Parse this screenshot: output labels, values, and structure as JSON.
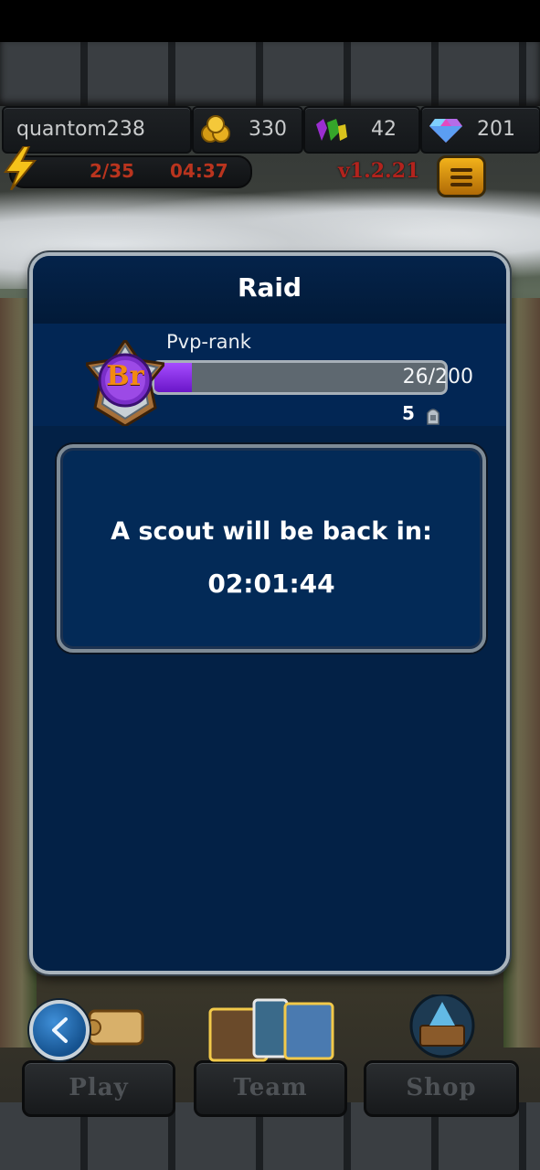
{
  "hud": {
    "player_name": "quantom238",
    "gold": "330",
    "gems": "42",
    "diamonds": "201",
    "energy": "2/35",
    "energy_timer": "04:37",
    "version": "v1.2.21",
    "icons": [
      "coin-icon",
      "gem-icon",
      "diamond-icon",
      "lightning-icon",
      "menu-icon"
    ]
  },
  "dialog": {
    "title": "Raid",
    "rank": {
      "label": "Pvp-rank",
      "badge": "Br",
      "progress_text": "26/200",
      "progress_fraction": 0.13,
      "count": "5"
    },
    "scout": {
      "message": "A scout will be back in:",
      "timer": "02:01:44"
    }
  },
  "nav": {
    "play": "Play",
    "team": "Team",
    "shop": "Shop"
  },
  "colors": {
    "dialog_bg": "#032146",
    "progress_fill": "#8a2ee6",
    "energy_text": "#b9341e",
    "version_text": "#b2231d"
  }
}
